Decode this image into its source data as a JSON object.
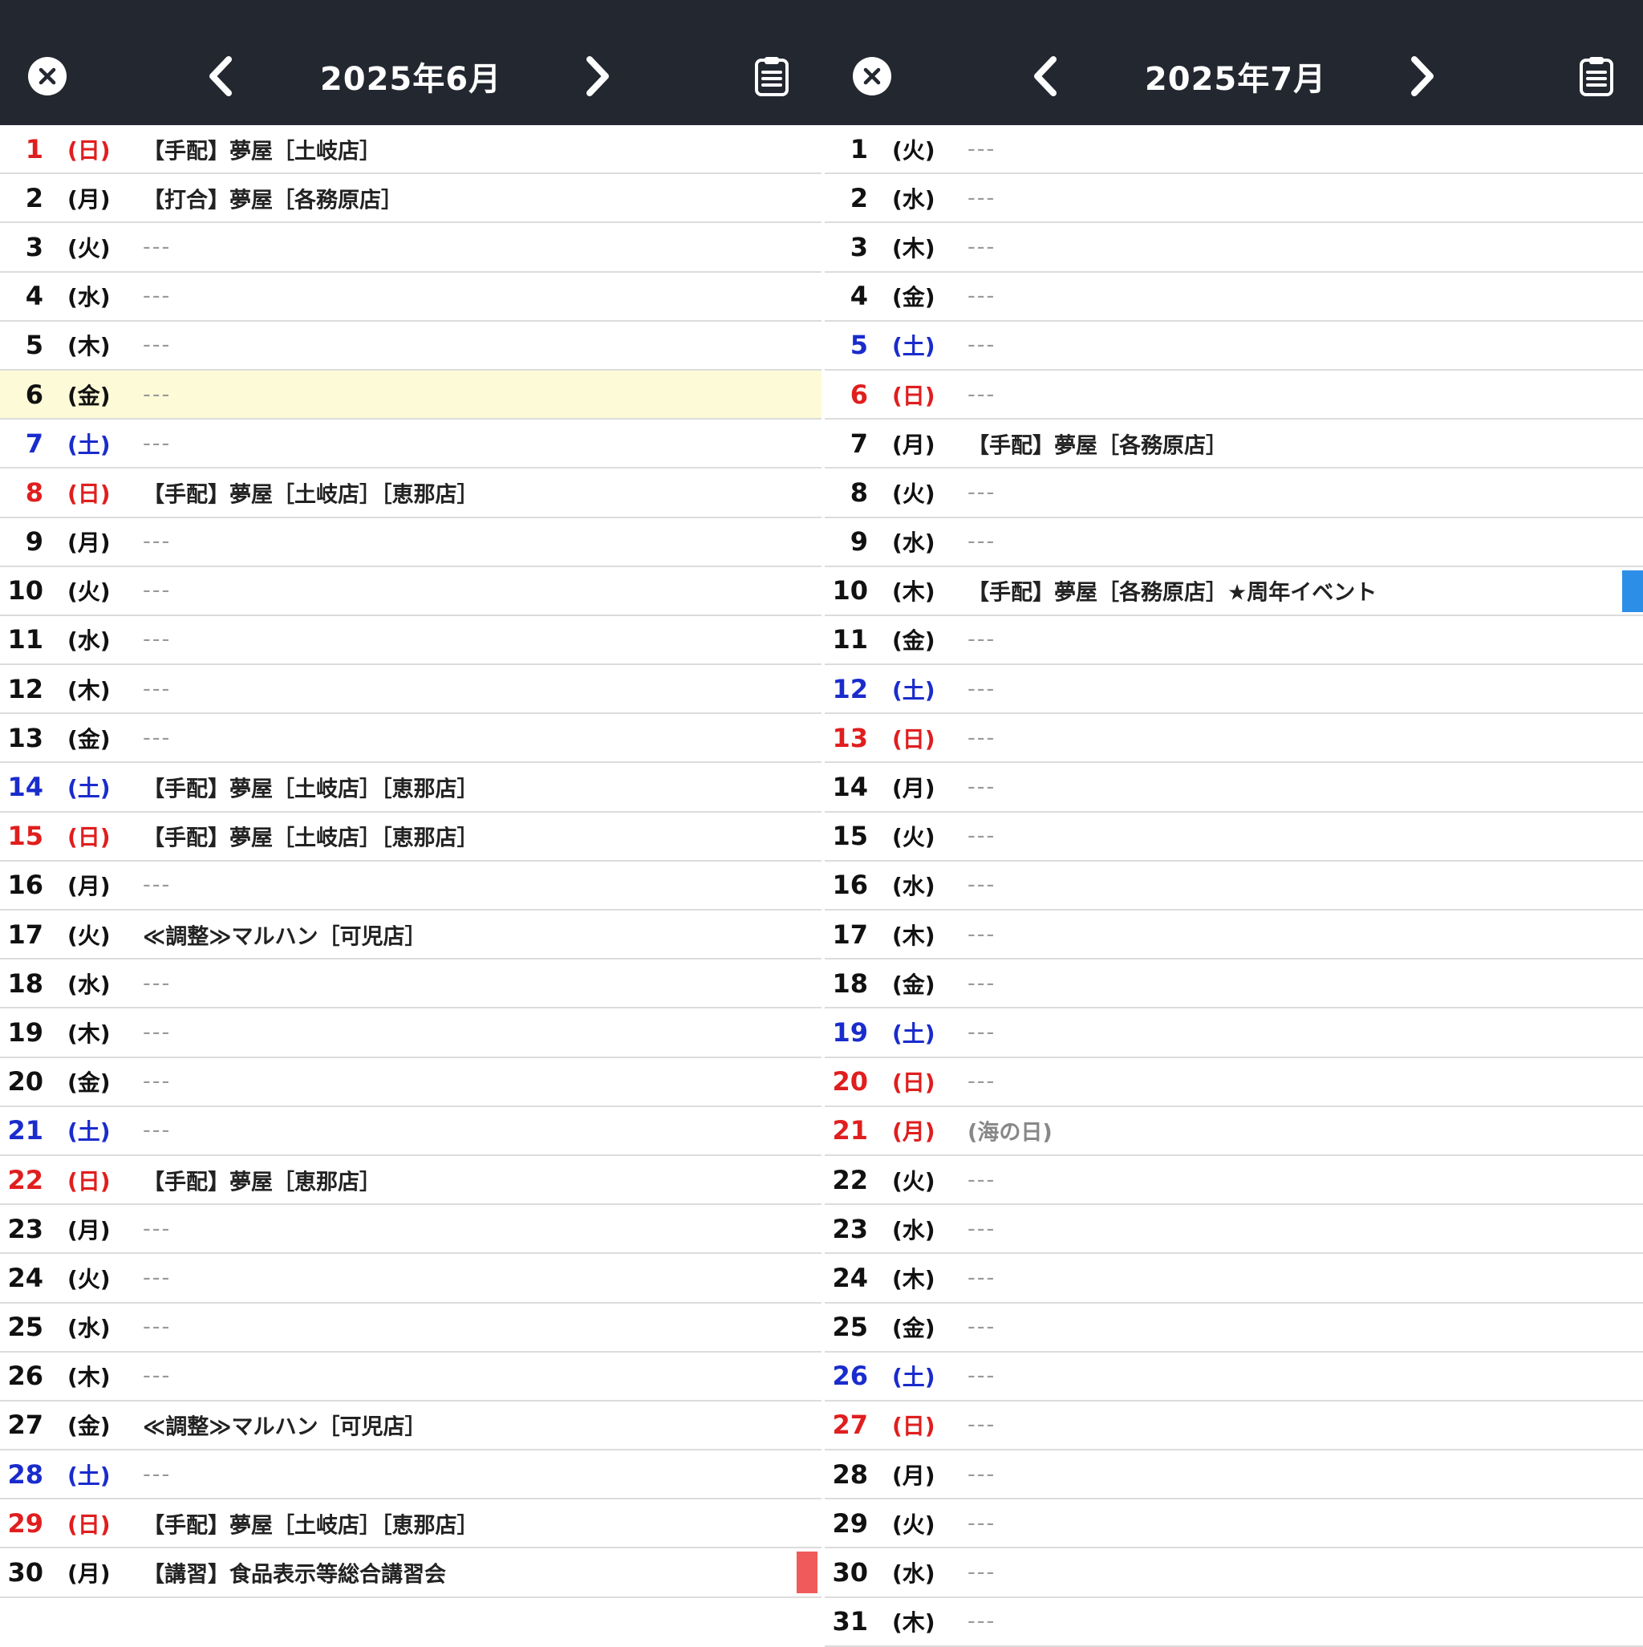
{
  "colors": {
    "header_bg": "#23272f",
    "sunday": "#e01e1e",
    "saturday": "#1a2ccc",
    "today_bg": "#fdfbd7",
    "marker_red": "#f05a5a",
    "marker_blue": "#2d8ee8"
  },
  "icons": {
    "close": "close-circle-icon",
    "prev": "chevron-left-icon",
    "next": "chevron-right-icon",
    "memo": "clipboard-icon"
  },
  "calendars": [
    {
      "title": "2025年6月",
      "days": [
        {
          "day": "1",
          "dow": "(日)",
          "event": "【手配】夢屋［土岐店］",
          "type": "sun"
        },
        {
          "day": "2",
          "dow": "(月)",
          "event": "【打合】夢屋［各務原店］",
          "type": "weekday"
        },
        {
          "day": "3",
          "dow": "(火)",
          "event": "---",
          "type": "weekday"
        },
        {
          "day": "4",
          "dow": "(水)",
          "event": "---",
          "type": "weekday"
        },
        {
          "day": "5",
          "dow": "(木)",
          "event": "---",
          "type": "weekday"
        },
        {
          "day": "6",
          "dow": "(金)",
          "event": "---",
          "type": "weekday",
          "today": true
        },
        {
          "day": "7",
          "dow": "(土)",
          "event": "---",
          "type": "sat"
        },
        {
          "day": "8",
          "dow": "(日)",
          "event": "【手配】夢屋［土岐店］［恵那店］",
          "type": "sun"
        },
        {
          "day": "9",
          "dow": "(月)",
          "event": "---",
          "type": "weekday"
        },
        {
          "day": "10",
          "dow": "(火)",
          "event": "---",
          "type": "weekday"
        },
        {
          "day": "11",
          "dow": "(水)",
          "event": "---",
          "type": "weekday"
        },
        {
          "day": "12",
          "dow": "(木)",
          "event": "---",
          "type": "weekday"
        },
        {
          "day": "13",
          "dow": "(金)",
          "event": "---",
          "type": "weekday"
        },
        {
          "day": "14",
          "dow": "(土)",
          "event": "【手配】夢屋［土岐店］［恵那店］",
          "type": "sat"
        },
        {
          "day": "15",
          "dow": "(日)",
          "event": "【手配】夢屋［土岐店］［恵那店］",
          "type": "sun"
        },
        {
          "day": "16",
          "dow": "(月)",
          "event": "---",
          "type": "weekday"
        },
        {
          "day": "17",
          "dow": "(火)",
          "event": "≪調整≫マルハン［可児店］",
          "type": "weekday"
        },
        {
          "day": "18",
          "dow": "(水)",
          "event": "---",
          "type": "weekday"
        },
        {
          "day": "19",
          "dow": "(木)",
          "event": "---",
          "type": "weekday"
        },
        {
          "day": "20",
          "dow": "(金)",
          "event": "---",
          "type": "weekday"
        },
        {
          "day": "21",
          "dow": "(土)",
          "event": "---",
          "type": "sat"
        },
        {
          "day": "22",
          "dow": "(日)",
          "event": "【手配】夢屋［恵那店］",
          "type": "sun"
        },
        {
          "day": "23",
          "dow": "(月)",
          "event": "---",
          "type": "weekday"
        },
        {
          "day": "24",
          "dow": "(火)",
          "event": "---",
          "type": "weekday"
        },
        {
          "day": "25",
          "dow": "(水)",
          "event": "---",
          "type": "weekday"
        },
        {
          "day": "26",
          "dow": "(木)",
          "event": "---",
          "type": "weekday"
        },
        {
          "day": "27",
          "dow": "(金)",
          "event": "≪調整≫マルハン［可児店］",
          "type": "weekday"
        },
        {
          "day": "28",
          "dow": "(土)",
          "event": "---",
          "type": "sat"
        },
        {
          "day": "29",
          "dow": "(日)",
          "event": "【手配】夢屋［土岐店］［恵那店］",
          "type": "sun"
        },
        {
          "day": "30",
          "dow": "(月)",
          "event": "【講習】食品表示等総合講習会",
          "type": "weekday",
          "marker": "red"
        }
      ]
    },
    {
      "title": "2025年7月",
      "days": [
        {
          "day": "1",
          "dow": "(火)",
          "event": "---",
          "type": "weekday"
        },
        {
          "day": "2",
          "dow": "(水)",
          "event": "---",
          "type": "weekday"
        },
        {
          "day": "3",
          "dow": "(木)",
          "event": "---",
          "type": "weekday"
        },
        {
          "day": "4",
          "dow": "(金)",
          "event": "---",
          "type": "weekday"
        },
        {
          "day": "5",
          "dow": "(土)",
          "event": "---",
          "type": "sat"
        },
        {
          "day": "6",
          "dow": "(日)",
          "event": "---",
          "type": "sun"
        },
        {
          "day": "7",
          "dow": "(月)",
          "event": "【手配】夢屋［各務原店］",
          "type": "weekday"
        },
        {
          "day": "8",
          "dow": "(火)",
          "event": "---",
          "type": "weekday"
        },
        {
          "day": "9",
          "dow": "(水)",
          "event": "---",
          "type": "weekday"
        },
        {
          "day": "10",
          "dow": "(木)",
          "event": "【手配】夢屋［各務原店］★周年イベント",
          "type": "weekday",
          "marker": "blue"
        },
        {
          "day": "11",
          "dow": "(金)",
          "event": "---",
          "type": "weekday"
        },
        {
          "day": "12",
          "dow": "(土)",
          "event": "---",
          "type": "sat"
        },
        {
          "day": "13",
          "dow": "(日)",
          "event": "---",
          "type": "sun"
        },
        {
          "day": "14",
          "dow": "(月)",
          "event": "---",
          "type": "weekday"
        },
        {
          "day": "15",
          "dow": "(火)",
          "event": "---",
          "type": "weekday"
        },
        {
          "day": "16",
          "dow": "(水)",
          "event": "---",
          "type": "weekday"
        },
        {
          "day": "17",
          "dow": "(木)",
          "event": "---",
          "type": "weekday"
        },
        {
          "day": "18",
          "dow": "(金)",
          "event": "---",
          "type": "weekday"
        },
        {
          "day": "19",
          "dow": "(土)",
          "event": "---",
          "type": "sat"
        },
        {
          "day": "20",
          "dow": "(日)",
          "event": "---",
          "type": "sun"
        },
        {
          "day": "21",
          "dow": "(月)",
          "event": "(海の日)",
          "type": "sun",
          "holiday": true
        },
        {
          "day": "22",
          "dow": "(火)",
          "event": "---",
          "type": "weekday"
        },
        {
          "day": "23",
          "dow": "(水)",
          "event": "---",
          "type": "weekday"
        },
        {
          "day": "24",
          "dow": "(木)",
          "event": "---",
          "type": "weekday"
        },
        {
          "day": "25",
          "dow": "(金)",
          "event": "---",
          "type": "weekday"
        },
        {
          "day": "26",
          "dow": "(土)",
          "event": "---",
          "type": "sat"
        },
        {
          "day": "27",
          "dow": "(日)",
          "event": "---",
          "type": "sun"
        },
        {
          "day": "28",
          "dow": "(月)",
          "event": "---",
          "type": "weekday"
        },
        {
          "day": "29",
          "dow": "(火)",
          "event": "---",
          "type": "weekday"
        },
        {
          "day": "30",
          "dow": "(水)",
          "event": "---",
          "type": "weekday"
        },
        {
          "day": "31",
          "dow": "(木)",
          "event": "---",
          "type": "weekday"
        }
      ]
    }
  ]
}
